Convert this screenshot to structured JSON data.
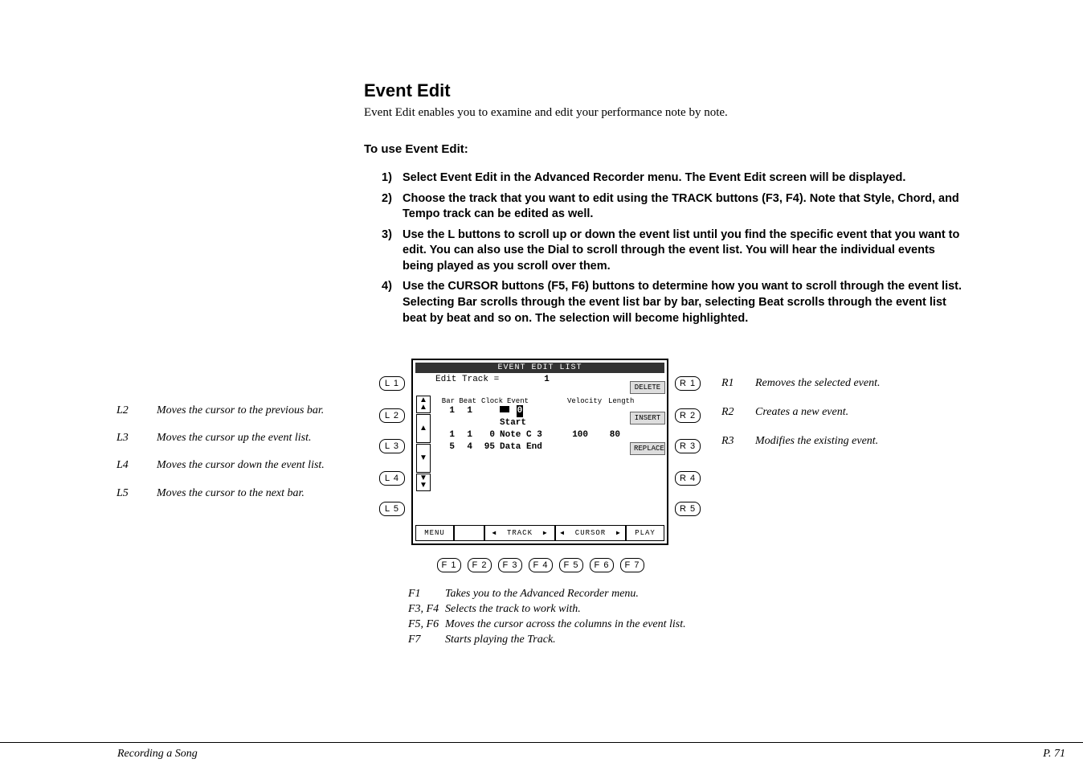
{
  "title": "Event Edit",
  "intro": "Event Edit enables you to examine and edit your performance note by note.",
  "subtitle": "To use Event Edit:",
  "steps": [
    "Select Event Edit in the Advanced Recorder menu.  The Event Edit screen will be displayed.",
    "Choose the track that you want to edit using the TRACK buttons (F3, F4).  Note that Style, Chord, and Tempo track can be edited as well.",
    "Use the L buttons to scroll up or down the event list  until you find the specific event that you want to edit.  You can also use the Dial to scroll through the event list.  You will hear the individual events being played as you scroll over them.",
    "Use the CURSOR buttons (F5, F6) buttons to determine how you want to scroll through the event list.  Selecting Bar scrolls through the event list bar by bar, selecting Beat scrolls through the event list beat by beat and so on.  The selection will become highlighted."
  ],
  "l_labels": [
    {
      "k": "L2",
      "d": "Moves the cursor to the previous bar."
    },
    {
      "k": "L3",
      "d": "Moves the cursor up the event list."
    },
    {
      "k": "L4",
      "d": "Moves the cursor down the event list."
    },
    {
      "k": "L5",
      "d": "Moves the cursor to the next bar."
    }
  ],
  "r_labels": [
    {
      "k": "R1",
      "d": "Removes the selected event."
    },
    {
      "k": "R2",
      "d": "Creates a new event."
    },
    {
      "k": "R3",
      "d": "Modifies the existing event."
    }
  ],
  "f_labels": [
    {
      "k": "F1",
      "d": "Takes you to the Advanced Recorder menu."
    },
    {
      "k": "F3, F4",
      "d": "Selects the track to work with."
    },
    {
      "k": "F5, F6",
      "d": "Moves the cursor across the columns in the event list."
    },
    {
      "k": "F7",
      "d": "Starts playing the Track."
    }
  ],
  "lcd": {
    "title": "EVENT EDIT LIST",
    "track_label": "Edit Track =",
    "track_num": "1",
    "cols": {
      "bar": "Bar",
      "beat": "Beat",
      "clock": "Clock",
      "event": "Event",
      "vel": "Velocity",
      "len": "Length"
    },
    "rows": [
      {
        "bar": "1",
        "beat": "1",
        "clock": "",
        "event_inv": "0",
        "event": "Start",
        "vel": "",
        "len": ""
      },
      {
        "bar": "1",
        "beat": "1",
        "clock": "0",
        "event": "Note C  3",
        "vel": "100",
        "len": "80"
      },
      {
        "bar": "5",
        "beat": "4",
        "clock": "95",
        "event": "Data End",
        "vel": "",
        "len": ""
      }
    ],
    "side_btns": [
      "DELETE",
      "INSERT",
      "REPLACE"
    ],
    "bottom": {
      "menu": "MENU",
      "track": "TRACK",
      "cursor": "CURSOR",
      "play": "PLAY"
    }
  },
  "btns": {
    "L": [
      "L 1",
      "L 2",
      "L 3",
      "L 4",
      "L 5"
    ],
    "R": [
      "R 1",
      "R 2",
      "R 3",
      "R 4",
      "R 5"
    ],
    "F": [
      "F 1",
      "F 2",
      "F 3",
      "F 4",
      "F 5",
      "F 6",
      "F 7"
    ]
  },
  "footer": {
    "left": "Recording a Song",
    "right": "P. 71"
  }
}
